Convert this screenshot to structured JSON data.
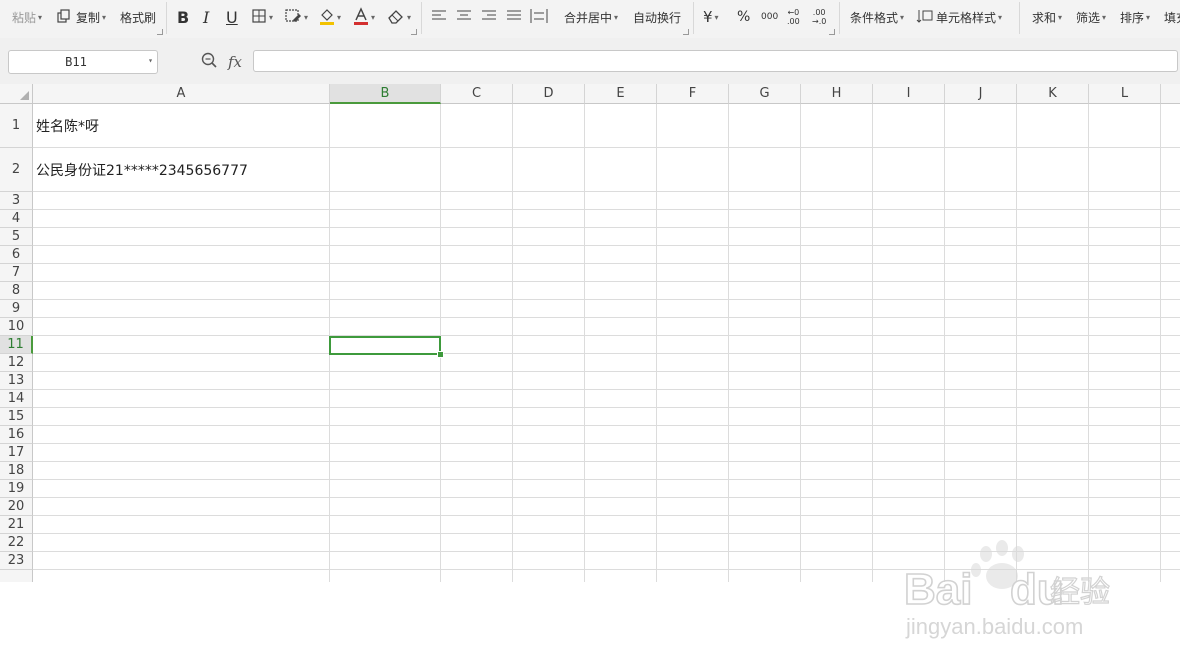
{
  "ribbon": {
    "paste": "粘贴",
    "copy": "复制",
    "format_painter": "格式刷",
    "bold": "B",
    "italic": "I",
    "underline": "U",
    "merge_center": "合并居中",
    "wrap_text": "自动换行",
    "currency": "¥",
    "percent": "%",
    "thousands": "000",
    "dec_increase_top": "←0",
    "dec_increase_bottom": ".00",
    "dec_decrease_top": ".00",
    "dec_decrease_bottom": "→.0",
    "conditional_format": "条件格式",
    "cell_style": "单元格样式",
    "sum": "求和",
    "filter": "筛选",
    "sort": "排序",
    "fill": "填充"
  },
  "formula_bar": {
    "name_box": "B11",
    "fx": "fx",
    "content": ""
  },
  "sheet": {
    "columns": [
      "A",
      "B",
      "C",
      "D",
      "E",
      "F",
      "G",
      "H",
      "I",
      "J",
      "K",
      "L"
    ],
    "rows": [
      "1",
      "2",
      "3",
      "4",
      "5",
      "6",
      "7",
      "8",
      "9",
      "10",
      "11",
      "12",
      "13",
      "14",
      "15",
      "16",
      "17",
      "18",
      "19",
      "20",
      "21",
      "22",
      "23"
    ],
    "cells": {
      "A1": "姓名陈*呀",
      "A2": "公民身份证21*****2345656777"
    },
    "selected_cell": "B11",
    "selected_column": "B",
    "selected_row": "11"
  },
  "colors": {
    "selection": "#3e9a3c",
    "grid": "#dcdcdc",
    "ribbon_bg": "#f3f3f3",
    "header_bg": "#f5f5f5",
    "font_color_bar": "#d32f2f",
    "fill_color_bar": "#f2c200"
  },
  "watermark": {
    "brand_left": "Bai",
    "brand_right": "du",
    "brand_cn": "经验",
    "url": "jingyan.baidu.com"
  }
}
